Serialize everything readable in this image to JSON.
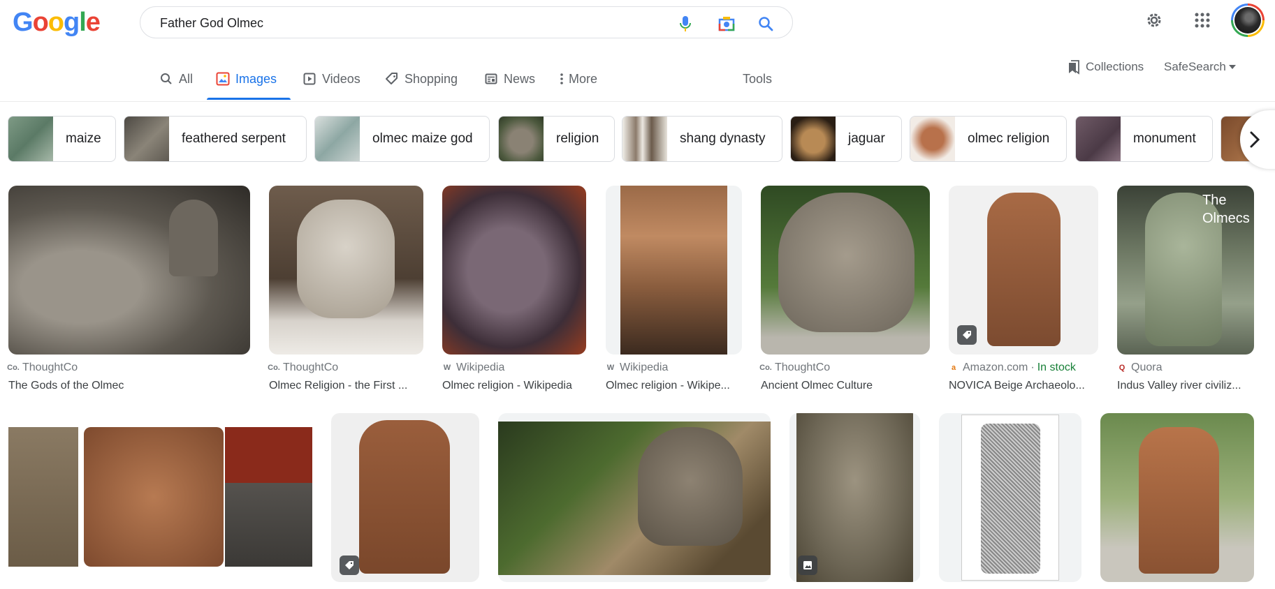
{
  "header": {
    "logo_letters": [
      {
        "ch": "G",
        "color": "#4285f4"
      },
      {
        "ch": "o",
        "color": "#ea4335"
      },
      {
        "ch": "o",
        "color": "#fbbc05"
      },
      {
        "ch": "g",
        "color": "#4285f4"
      },
      {
        "ch": "l",
        "color": "#34a853"
      },
      {
        "ch": "e",
        "color": "#ea4335"
      }
    ],
    "search_value": "Father God Olmec",
    "icons": [
      "mic-icon",
      "camera-lens-icon",
      "search-icon",
      "gear-icon",
      "apps-grid-icon"
    ]
  },
  "tabs": [
    {
      "label": "All",
      "icon": "search-icon",
      "active": false
    },
    {
      "label": "Images",
      "icon": "image-icon",
      "active": true
    },
    {
      "label": "Videos",
      "icon": "video-icon",
      "active": false
    },
    {
      "label": "Shopping",
      "icon": "tag-icon",
      "active": false
    },
    {
      "label": "News",
      "icon": "news-icon",
      "active": false
    },
    {
      "label": "More",
      "icon": "dots-vertical-icon",
      "active": false
    },
    {
      "label": "Tools",
      "icon": "",
      "active": false
    }
  ],
  "toolbar": {
    "collections_label": "Collections",
    "safesearch_label": "SafeSearch"
  },
  "chips": [
    {
      "label": "maize"
    },
    {
      "label": "feathered serpent"
    },
    {
      "label": "olmec maize god"
    },
    {
      "label": "religion"
    },
    {
      "label": "shang dynasty"
    },
    {
      "label": "jaguar"
    },
    {
      "label": "olmec religion"
    },
    {
      "label": "monument"
    }
  ],
  "results_row1": [
    {
      "source": "ThoughtCo",
      "title": "The Gods of the Olmec"
    },
    {
      "source": "ThoughtCo",
      "title": "Olmec Religion - the First ..."
    },
    {
      "source": "Wikipedia",
      "title": "Olmec religion - Wikipedia"
    },
    {
      "source": "Wikipedia",
      "title": "Olmec religion - Wikipe..."
    },
    {
      "source": "ThoughtCo",
      "title": "Ancient Olmec Culture"
    },
    {
      "source": "Amazon.com",
      "stock": "In stock",
      "title": "NOVICA Beige Archaeolo..."
    },
    {
      "source": "Quora",
      "title": "Indus Valley river civiliz...",
      "overlay": "The Olmecs"
    }
  ],
  "colors": {
    "accent": "#1a73e8",
    "secondary_text": "#70757a",
    "in_stock": "#188038"
  }
}
